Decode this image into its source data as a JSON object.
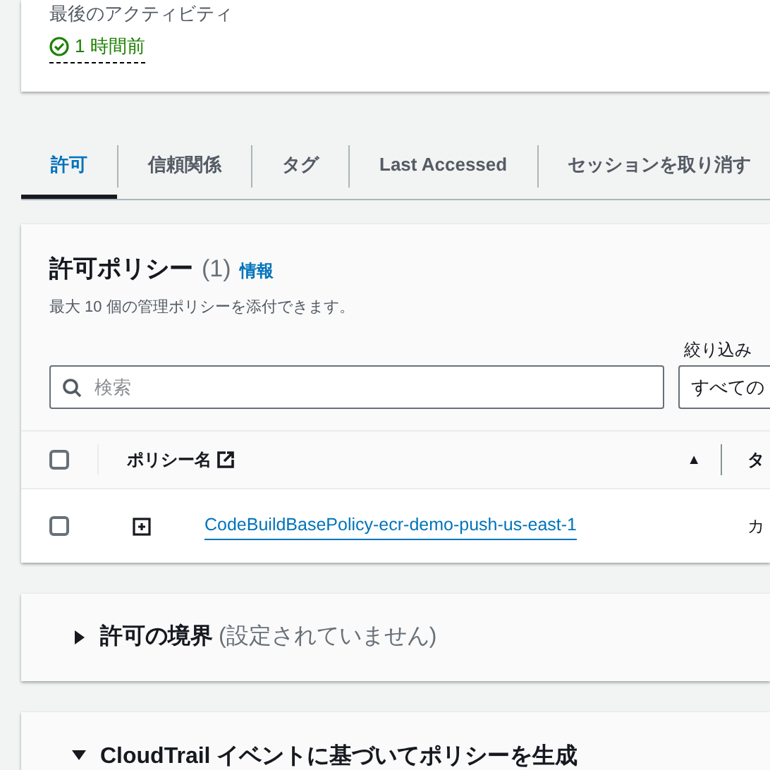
{
  "summary": {
    "label": "最後のアクティビティ",
    "value": "1 時間前"
  },
  "tabs": [
    {
      "label": "許可",
      "selected": true
    },
    {
      "label": "信頼関係",
      "selected": false
    },
    {
      "label": "タグ",
      "selected": false
    },
    {
      "label": "Last Accessed",
      "selected": false
    },
    {
      "label": "セッションを取り消す",
      "selected": false
    }
  ],
  "policies": {
    "title": "許可ポリシー",
    "count": "(1)",
    "info": "情報",
    "description": "最大 10 個の管理ポリシーを添付できます。",
    "filter_label": "絞り込み",
    "search": {
      "placeholder": "検索"
    },
    "filter_select": {
      "value": "すべての"
    },
    "table": {
      "columns": [
        {
          "label": "ポリシー名",
          "sort": "▲"
        },
        {
          "label": "タ"
        }
      ],
      "rows": [
        {
          "checked": false,
          "expanded": false,
          "name": "CodeBuildBasePolicy-ecr-demo-push-us-east-1",
          "column_2": "カ"
        }
      ],
      "all_checked": false
    }
  },
  "boundary": {
    "title": "許可の境界",
    "status": "(設定されていません)",
    "expanded": false
  },
  "cloudtrail": {
    "title": "CloudTrail イベントに基づいてポリシーを生成",
    "expanded": true
  }
}
